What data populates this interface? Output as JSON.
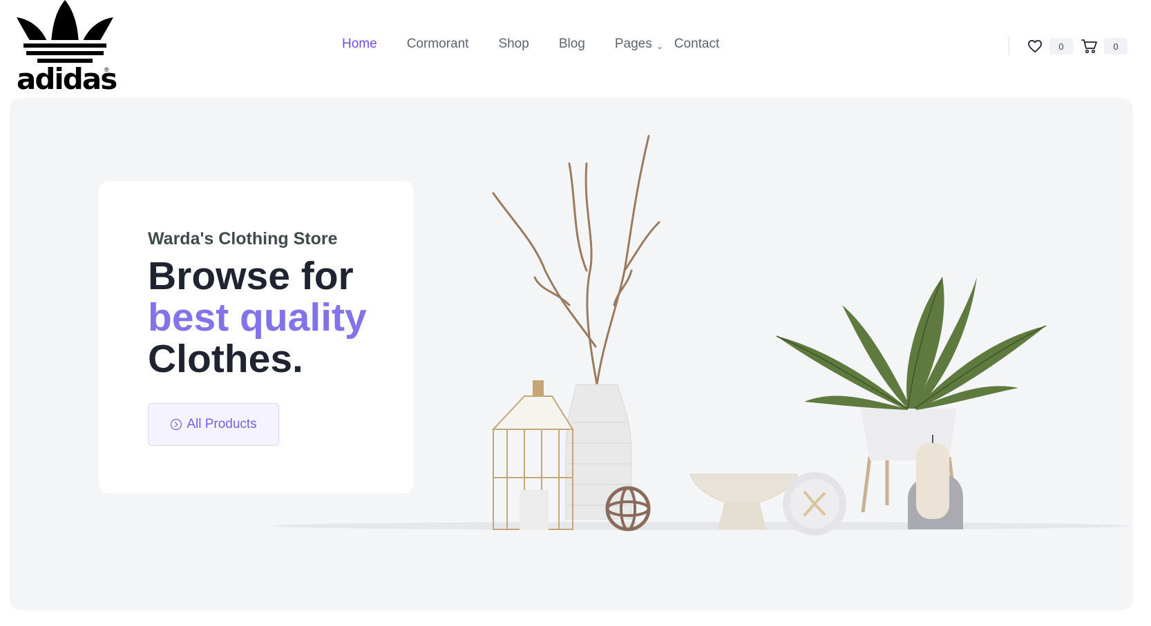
{
  "brand": {
    "wordmark": "adidas",
    "trademark": "®",
    "logo_icon": "trefoil-logo-icon"
  },
  "nav": {
    "items": [
      {
        "label": "Home",
        "active": true
      },
      {
        "label": "Cormorant",
        "active": false
      },
      {
        "label": "Shop",
        "active": false
      },
      {
        "label": "Blog",
        "active": false
      },
      {
        "label": "Pages",
        "active": false,
        "dropdown": true
      },
      {
        "label": "Contact",
        "active": false
      }
    ],
    "dropdown_icon": "chevron-down-icon"
  },
  "header_actions": {
    "wishlist_icon": "heart-icon",
    "wishlist_count": "0",
    "cart_icon": "cart-icon",
    "cart_count": "0"
  },
  "hero": {
    "eyebrow": "Warda's Clothing Store",
    "headline_line1": "Browse for",
    "headline_line2": "best quality",
    "headline_line3": "Clothes.",
    "cta_label": "All Products",
    "cta_icon": "chevron-circle-right-icon"
  },
  "colors": {
    "accent": "#6a4cf0",
    "accent_soft": "#8373ea",
    "hero_bg": "#f4f5f7",
    "text_dark": "#1f2430",
    "nav_text": "#5b6370"
  }
}
